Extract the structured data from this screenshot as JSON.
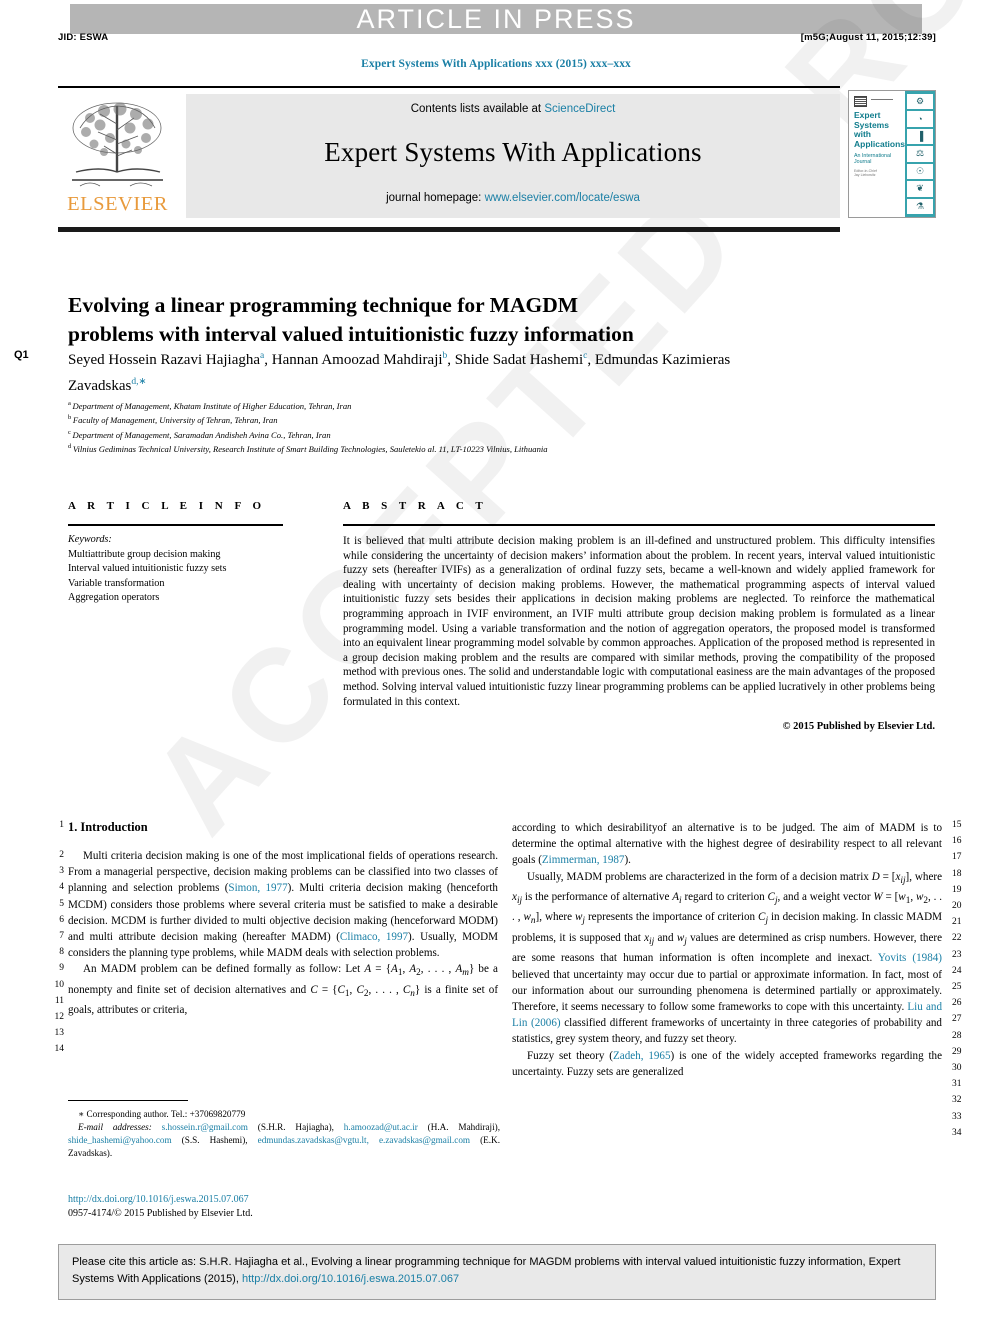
{
  "banner": {
    "label": "ARTICLE IN PRESS"
  },
  "running_head": {
    "left": "JID: ESWA",
    "right": "[m5G;August 11, 2015;12:39]"
  },
  "journal_line": "Expert Systems With Applications xxx (2015) xxx–xxx",
  "masthead": {
    "contents_prefix": "Contents lists available at ",
    "sciencedirect": "ScienceDirect",
    "journal_title": "Expert Systems With Applications",
    "homepage_prefix": "journal homepage: ",
    "homepage_url": "www.elsevier.com/locate/eswa",
    "publisher_wordmark": "ELSEVIER",
    "cover": {
      "title_line1": "Expert",
      "title_line2": "Systems",
      "title_line3": "with",
      "title_line4": "Applications",
      "subtitle_line1": "An International",
      "subtitle_line2": "Journal",
      "tiny_line1": "Editor-in-Chief",
      "tiny_line2": "Jay Liebowitz",
      "icons": [
        "⚙",
        "◔",
        "▐",
        "⚖",
        "☉",
        "❦",
        "⚗"
      ]
    }
  },
  "query_marker": "Q1",
  "title": "Evolving a linear programming technique for MAGDM problems with interval valued intuitionistic fuzzy information",
  "authors": [
    {
      "name": "Seyed Hossein Razavi Hajiagha",
      "sup": "a",
      "sep": ", "
    },
    {
      "name": "Hannan Amoozad Mahdiraji",
      "sup": "b",
      "sep": ", "
    },
    {
      "name": "Shide Sadat Hashemi",
      "sup": "c",
      "sep": ", "
    },
    {
      "name": "Edmundas Kazimieras Zavadskas",
      "sup": "d,∗",
      "sep": ""
    }
  ],
  "affiliations": [
    {
      "mark": "a",
      "text": "Department of Management, Khatam Institute of Higher Education, Tehran, Iran"
    },
    {
      "mark": "b",
      "text": "Faculty of Management, University of Tehran, Tehran, Iran"
    },
    {
      "mark": "c",
      "text": "Department of Management, Saramadan Andisheh Avina Co., Tehran, Iran"
    },
    {
      "mark": "d",
      "text": "Vilnius Gediminas Technical University, Research Institute of Smart Building Technologies, Sauletekio al. 11, LT-10223 Vilnius, Lithuania"
    }
  ],
  "article_info": {
    "heading": "A R T I C L E   I N F O",
    "keywords_label": "Keywords:",
    "keywords": [
      "Multiattribute group decision making",
      "Interval valued intuitionistic fuzzy sets",
      "Variable transformation",
      "Aggregation operators"
    ]
  },
  "abstract": {
    "heading": "A B S T R A C T",
    "body": "It is believed that multi attribute decision making problem is an ill-defined and unstructured problem. This difficulty intensifies while considering the uncertainty of decision makers’ information about the problem. In recent years, interval valued intuitionistic fuzzy sets (hereafter IVIFs) as a generalization of ordinal fuzzy sets, became a well-known and widely applied framework for dealing with uncertainty of decision making problems. However, the mathematical programming aspects of interval valued intuitionistic fuzzy sets besides their applications in decision making problems are neglected. To reinforce the mathematical programming approach in IVIF environment, an IVIF multi attribute group decision making problem is formulated as a linear programming model. Using a variable transformation and the notion of aggregation operators, the proposed model is transformed into an equivalent linear programming model solvable by common approaches. Application of the proposed method is represented in a group decision making problem and the results are compared with similar methods, proving the compatibility of the proposed method with previous ones. The solid and understandable logic with computational easiness are the main advantages of the proposed method. Solving interval valued intuitionistic fuzzy linear programming problems can be applied lucratively in other problems being formulated in this context.",
    "copyright": "© 2015 Published by Elsevier Ltd."
  },
  "body": {
    "section_title": "1. Introduction",
    "left_paragraphs": [
      "Multi criteria decision making is one of the most implicational fields of operations research. From a managerial perspective, decision making problems can be classified into two classes of planning and selection problems (<span class=\"cite\">Simon, 1977</span>). Multi criteria decision making (henceforth MCDM) considers those problems where several criteria must be satisfied to make a desirable decision. MCDM is further divided to multi objective decision making (henceforward MODM) and multi attribute decision making (hereafter MADM) (<span class=\"cite\">Climaco, 1997</span>). Usually, MODM considers the planning type problems, while MADM deals with selection problems.",
      "An MADM problem can be defined formally as follow: Let <i>A</i> = {<i>A</i><sub>1</sub>, <i>A</i><sub>2</sub>, . . . , <i>A<sub>m</sub></i>} be a nonempty and finite set of decision alternatives and <i>C</i> = {<i>C</i><sub>1</sub>, <i>C</i><sub>2</sub>, . . . , <i>C<sub>n</sub></i>} is a finite set of goals, attributes or criteria,"
    ],
    "right_paragraphs": [
      "according to which desirabilityof an alternative is to be judged. The aim of MADM is to determine the optimal alternative with the highest degree of desirability respect to all relevant goals (<span class=\"cite\">Zimmerman, 1987</span>).",
      "Usually, MADM problems are characterized in the form of a decision matrix <i>D</i> = [<i>x<sub>ij</sub></i>], where <i>x<sub>ij</sub></i> is the performance of alternative <i>A<sub>i</sub></i> regard to criterion <i>C<sub>j</sub></i>, and a weight vector <i>W</i> = [<i>w</i><sub>1</sub>, <i>w</i><sub>2</sub>, . . . , <i>w<sub>n</sub></i>], where <i>w<sub>j</sub></i> represents the importance of criterion <i>C<sub>j</sub></i> in decision making. In classic MADM problems, it is supposed that <i>x<sub>ij</sub></i> and <i>w<sub>j</sub></i> values are determined as crisp numbers. However, there are some reasons that human information is often incomplete and inexact. <span class=\"cite\">Yovits (1984)</span> believed that uncertainty may occur due to partial or approximate information. In fact, most of our information about our surrounding phenomena is determined partially or approximately. Therefore, it seems necessary to follow some frameworks to cope with this uncertainty. <span class=\"cite\">Liu and Lin (2006)</span> classified different frameworks of uncertainty in three categories of probability and statistics, grey system theory, and fuzzy set theory.",
      "Fuzzy set theory (<span class=\"cite\">Zadeh, 1965</span>) is one of the widely accepted frameworks regarding the uncertainty. Fuzzy sets are generalized"
    ],
    "line_numbers_left": [
      "1",
      "2",
      "3",
      "4",
      "5",
      "6",
      "7",
      "8",
      "9",
      "10",
      "11",
      "12",
      "13",
      "14"
    ],
    "line_numbers_right": [
      "15",
      "16",
      "17",
      "18",
      "19",
      "20",
      "21",
      "22",
      "23",
      "24",
      "25",
      "26",
      "27",
      "28",
      "29",
      "30",
      "31",
      "32",
      "33",
      "34"
    ]
  },
  "footnote": {
    "corresponding": "∗ Corresponding author. Tel.: +37069820779",
    "email_label": "E-mail addresses:",
    "emails": [
      {
        "address": "s.hossein.r@gmail.com",
        "owner": "(S.H.R. Hajiagha)"
      },
      {
        "address": "h.amoozad@ut.ac.ir",
        "owner": "(H.A. Mahdiraji)"
      },
      {
        "address": "shide_hashemi@yahoo.com",
        "owner": "(S.S. Hashemi)"
      },
      {
        "address": "edmundas.zavadskas@vgtu.lt, e.zavadskas@gmail.com",
        "owner": "(E.K. Zavadskas)"
      }
    ]
  },
  "doi_block": {
    "doi_url": "http://dx.doi.org/10.1016/j.eswa.2015.07.067",
    "issn_line": "0957-4174/© 2015 Published by Elsevier Ltd."
  },
  "cite_box": {
    "text_before": "Please cite this article as: S.H.R. Hajiagha et al., Evolving a linear programming technique for MAGDM problems with interval valued intuitionistic fuzzy information, Expert Systems With Applications (2015), ",
    "link": "http://dx.doi.org/10.1016/j.eswa.2015.07.067"
  },
  "watermark": "ACCEPTED PROOF",
  "colors": {
    "link": "#1a7fa5",
    "banner_bg": "#b5b5b5",
    "masthead_bg": "#e8e8e8",
    "elsevier_orange": "#e89a3c",
    "cover_teal": "#37a3ad"
  }
}
